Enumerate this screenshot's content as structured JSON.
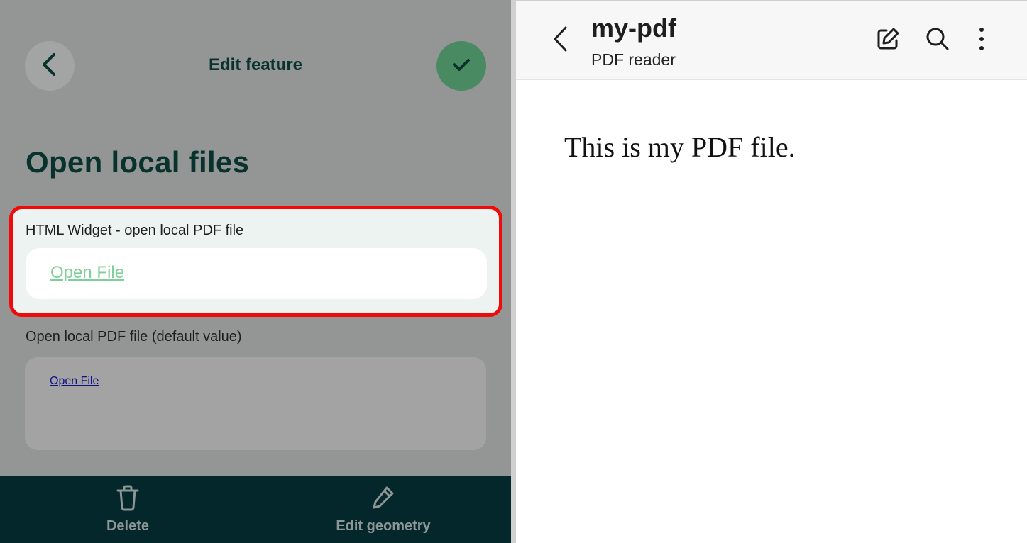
{
  "left_panel": {
    "header": {
      "title": "Edit feature"
    },
    "page_title": "Open local files",
    "widget": {
      "label": "HTML Widget - open local PDF file",
      "link_text": "Open File",
      "highlight_color": "#f00a0a"
    },
    "default_field": {
      "label": "Open local PDF file (default value)",
      "link_text": "Open File"
    },
    "bottom_bar": {
      "delete_label": "Delete",
      "edit_geometry_label": "Edit geometry"
    },
    "colors": {
      "accent": "#4a8a63",
      "dark": "#03272a",
      "link_green": "#7fcf98"
    },
    "icons": [
      "back-arrow-icon",
      "checkmark-icon",
      "trash-icon",
      "pencil-icon"
    ]
  },
  "right_panel": {
    "header": {
      "title": "my-pdf",
      "subtitle": "PDF reader"
    },
    "content_text": "This is my PDF file.",
    "icons": [
      "back-arrow-icon",
      "edit-icon",
      "search-icon",
      "more-vertical-icon"
    ]
  }
}
